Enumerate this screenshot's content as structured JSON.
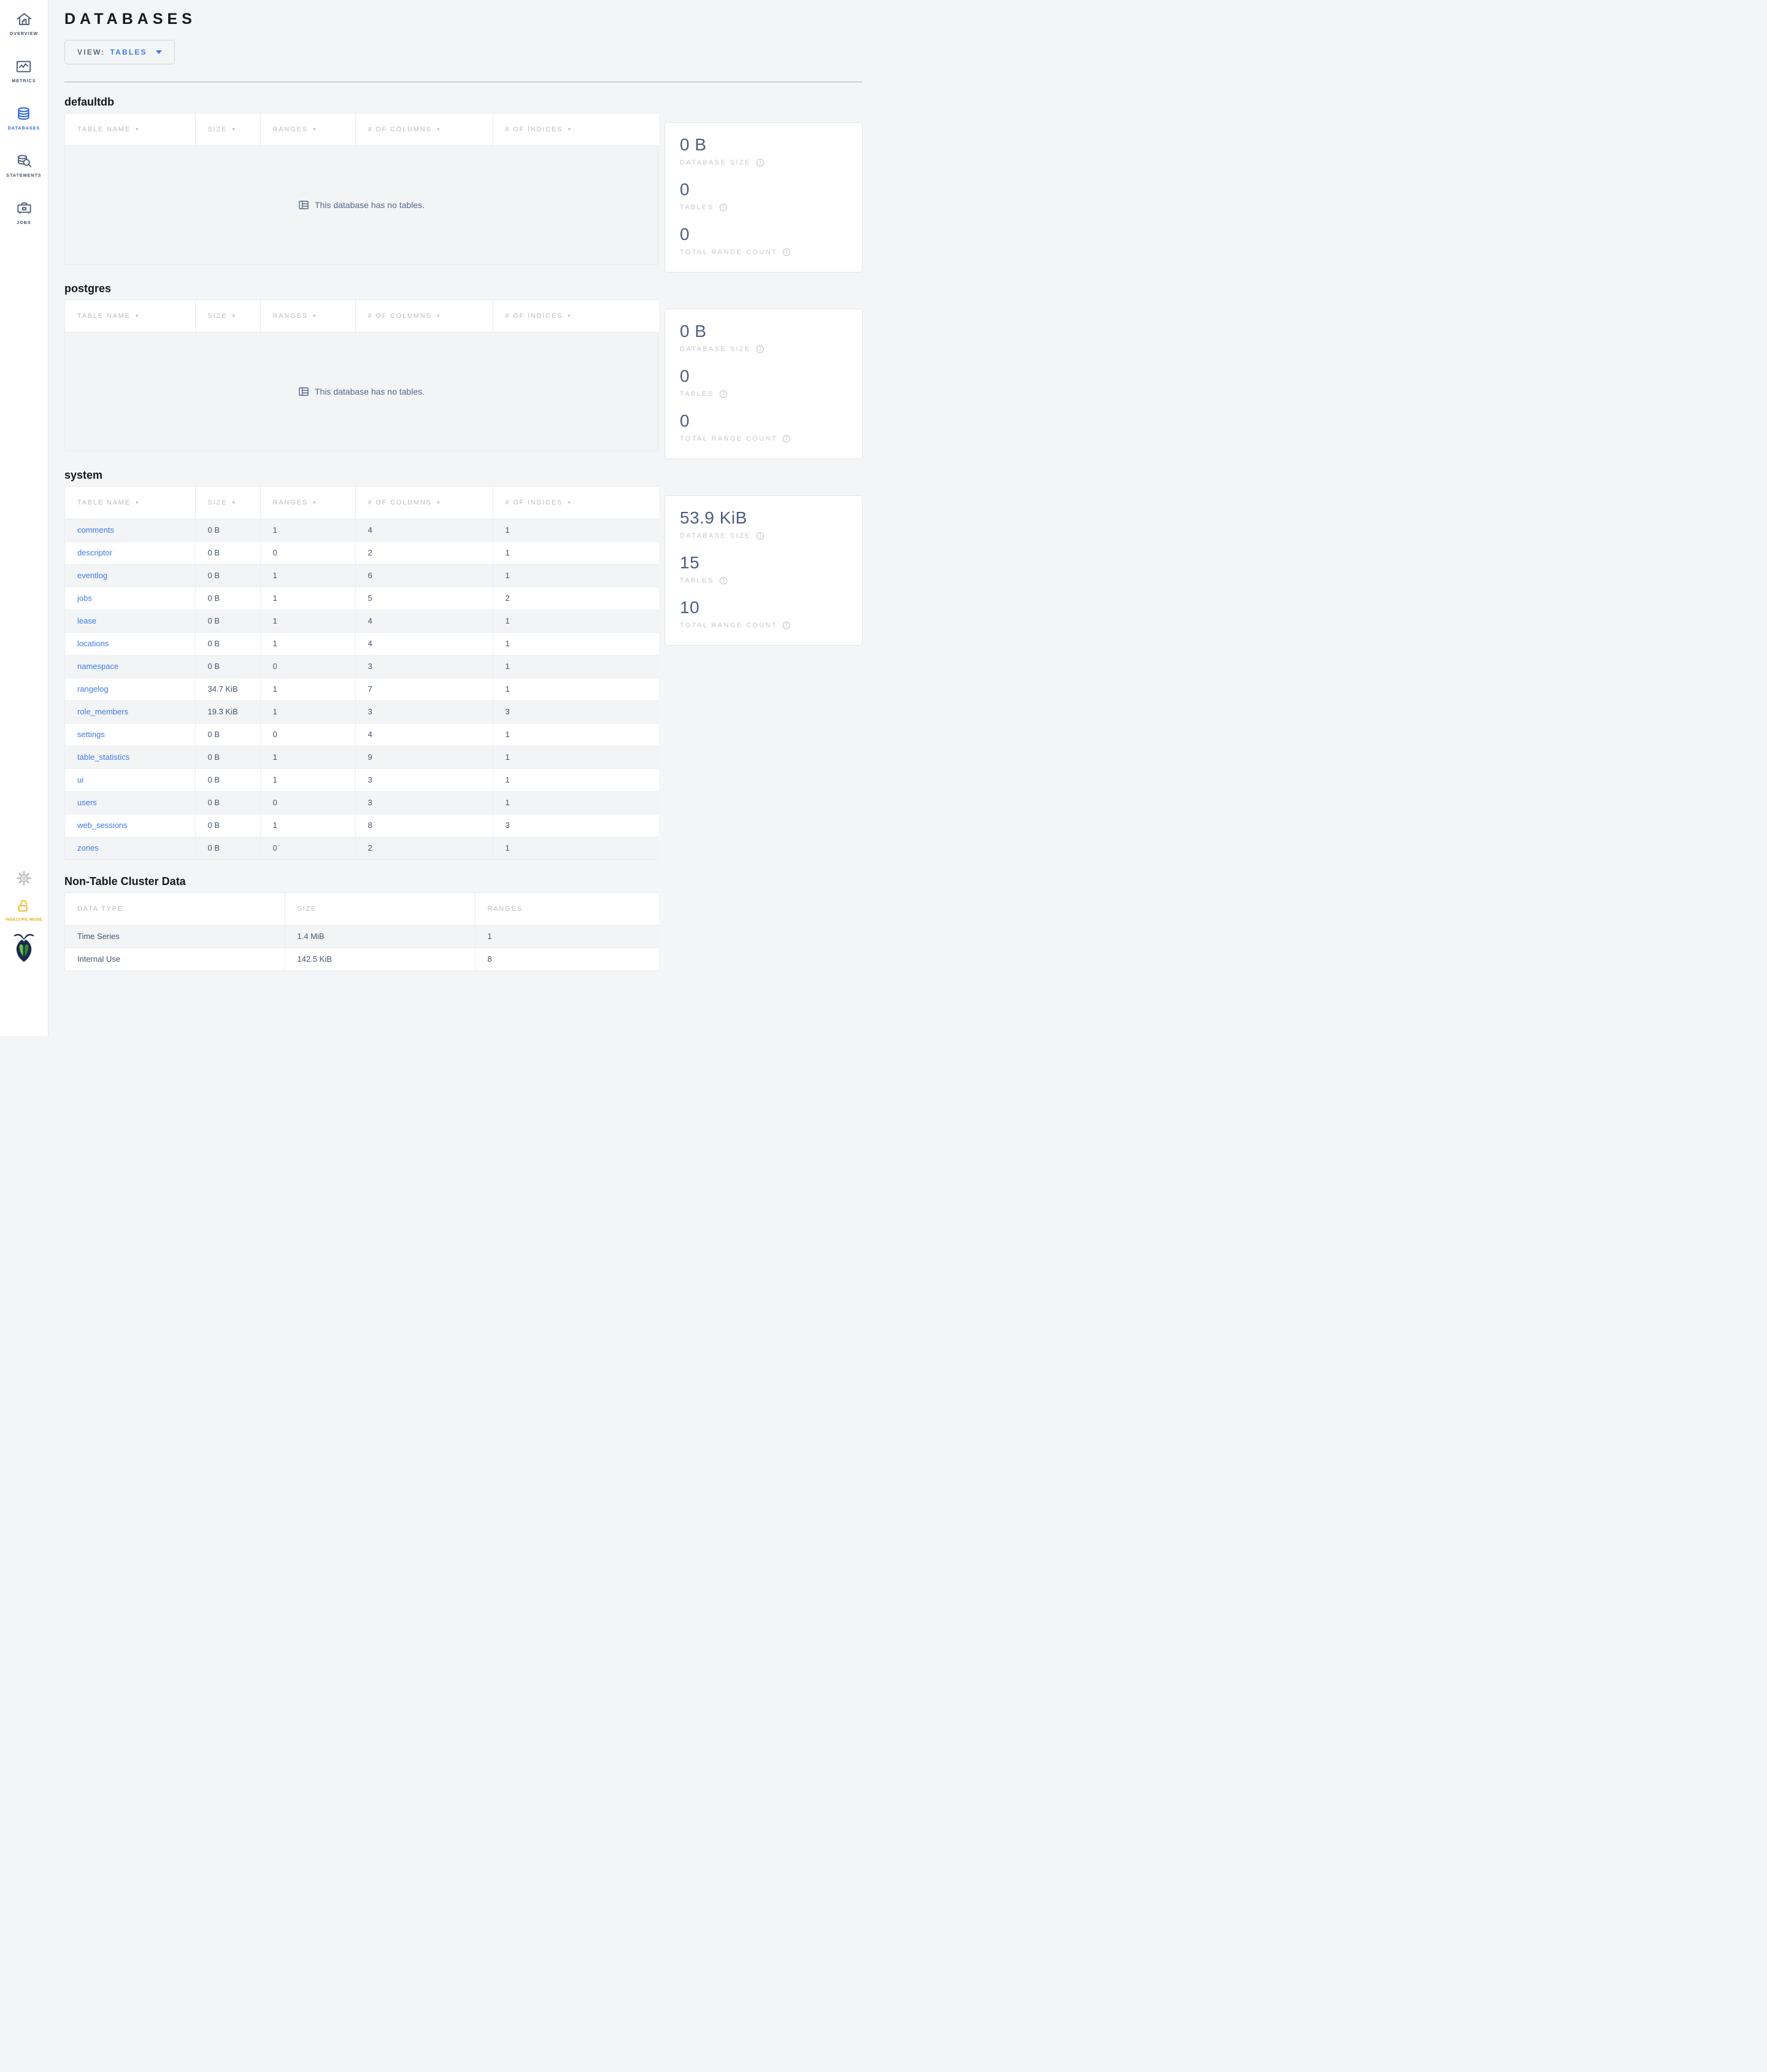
{
  "sidebar": {
    "items": [
      {
        "label": "OVERVIEW"
      },
      {
        "label": "METRICS"
      },
      {
        "label": "DATABASES"
      },
      {
        "label": "STATEMENTS"
      },
      {
        "label": "JOBS"
      }
    ],
    "insecure_label": "INSECURE MODE"
  },
  "header": {
    "title": "DATABASES",
    "view_label": "VIEW:",
    "view_value": "TABLES"
  },
  "icons": {
    "sort_caret": "▼"
  },
  "columns": [
    "TABLE NAME",
    "SIZE",
    "RANGES",
    "# OF COLUMNS",
    "# OF INDICES"
  ],
  "stats_labels": {
    "size": "DATABASE SIZE",
    "tables": "TABLES",
    "ranges": "TOTAL RANGE COUNT"
  },
  "empty_message": "This database has no tables.",
  "databases": [
    {
      "name": "defaultdb",
      "size": "0 B",
      "tables": "0",
      "range_count": "0"
    },
    {
      "name": "postgres",
      "size": "0 B",
      "tables": "0",
      "range_count": "0"
    },
    {
      "name": "system",
      "size": "53.9 KiB",
      "tables": "15",
      "range_count": "10"
    }
  ],
  "system_rows": [
    {
      "name": "comments",
      "size": "0 B",
      "ranges": "1",
      "columns": "4",
      "indices": "1"
    },
    {
      "name": "descriptor",
      "size": "0 B",
      "ranges": "0",
      "columns": "2",
      "indices": "1"
    },
    {
      "name": "eventlog",
      "size": "0 B",
      "ranges": "1",
      "columns": "6",
      "indices": "1"
    },
    {
      "name": "jobs",
      "size": "0 B",
      "ranges": "1",
      "columns": "5",
      "indices": "2"
    },
    {
      "name": "lease",
      "size": "0 B",
      "ranges": "1",
      "columns": "4",
      "indices": "1"
    },
    {
      "name": "locations",
      "size": "0 B",
      "ranges": "1",
      "columns": "4",
      "indices": "1"
    },
    {
      "name": "namespace",
      "size": "0 B",
      "ranges": "0",
      "columns": "3",
      "indices": "1"
    },
    {
      "name": "rangelog",
      "size": "34.7 KiB",
      "ranges": "1",
      "columns": "7",
      "indices": "1"
    },
    {
      "name": "role_members",
      "size": "19.3 KiB",
      "ranges": "1",
      "columns": "3",
      "indices": "3"
    },
    {
      "name": "settings",
      "size": "0 B",
      "ranges": "0",
      "columns": "4",
      "indices": "1"
    },
    {
      "name": "table_statistics",
      "size": "0 B",
      "ranges": "1",
      "columns": "9",
      "indices": "1"
    },
    {
      "name": "ui",
      "size": "0 B",
      "ranges": "1",
      "columns": "3",
      "indices": "1"
    },
    {
      "name": "users",
      "size": "0 B",
      "ranges": "0",
      "columns": "3",
      "indices": "1"
    },
    {
      "name": "web_sessions",
      "size": "0 B",
      "ranges": "1",
      "columns": "8",
      "indices": "3"
    },
    {
      "name": "zones",
      "size": "0 B",
      "ranges": "0",
      "columns": "2",
      "indices": "1"
    }
  ],
  "non_table": {
    "title": "Non-Table Cluster Data",
    "columns": [
      "DATA TYPE",
      "SIZE",
      "RANGES"
    ],
    "rows": [
      {
        "type": "Time Series",
        "size": "1.4 MiB",
        "ranges": "1"
      },
      {
        "type": "Internal Use",
        "size": "142.5 KiB",
        "ranges": "8"
      }
    ]
  },
  "colors": {
    "accent_blue": "#2a66d9",
    "link_blue": "#3d7be5",
    "insecure_yellow": "#e3a90f",
    "stat_slate": "#4e5e80"
  }
}
